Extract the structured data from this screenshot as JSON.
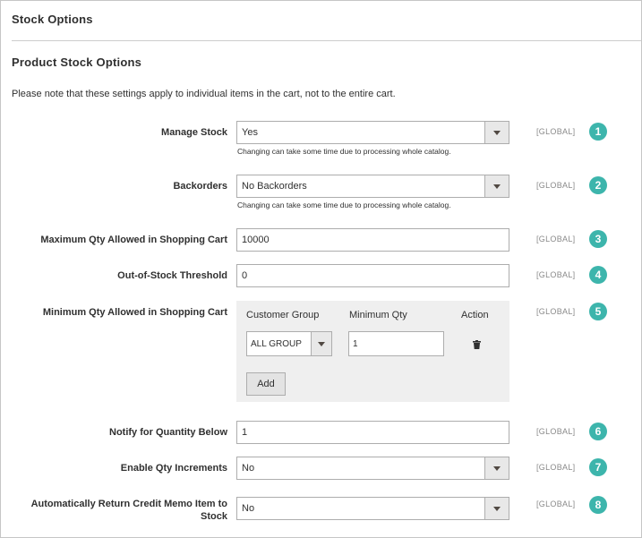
{
  "section_title": "Stock Options",
  "group_title": "Product Stock Options",
  "note": "Please note that these settings apply to individual items in the cart, not to the entire cart.",
  "scope_label": "[GLOBAL]",
  "badge_color": "#3db5ac",
  "fields": {
    "manage_stock": {
      "label": "Manage Stock",
      "value": "Yes",
      "hint": "Changing can take some time due to processing whole catalog.",
      "badge": "1"
    },
    "backorders": {
      "label": "Backorders",
      "value": "No Backorders",
      "hint": "Changing can take some time due to processing whole catalog.",
      "badge": "2"
    },
    "max_qty": {
      "label": "Maximum Qty Allowed in Shopping Cart",
      "value": "10000",
      "badge": "3"
    },
    "oos_threshold": {
      "label": "Out-of-Stock Threshold",
      "value": "0",
      "badge": "4"
    },
    "min_qty": {
      "label": "Minimum Qty Allowed in Shopping Cart",
      "badge": "5",
      "columns": {
        "customer_group": "Customer Group",
        "minimum_qty": "Minimum Qty",
        "action": "Action"
      },
      "row": {
        "customer_group": "ALL GROUP",
        "minimum_qty": "1"
      },
      "add_label": "Add"
    },
    "notify_below": {
      "label": "Notify for Quantity Below",
      "value": "1",
      "badge": "6"
    },
    "qty_increments": {
      "label": "Enable Qty Increments",
      "value": "No",
      "badge": "7"
    },
    "return_credit_memo": {
      "label": "Automatically Return Credit Memo Item to Stock",
      "value": "No",
      "badge": "8"
    }
  }
}
